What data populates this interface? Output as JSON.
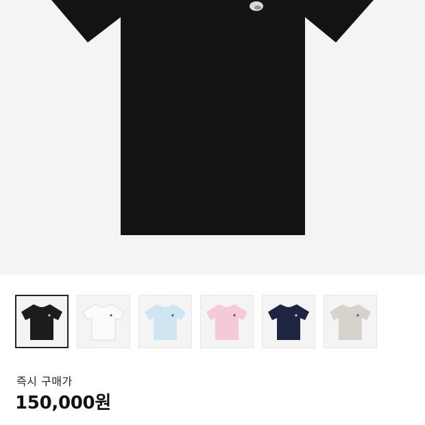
{
  "product": {
    "main_image_icon": "black-tshirt-image",
    "thumbnails": [
      {
        "name": "black",
        "color": "#1c1c1c",
        "logo": "#cfcfcf",
        "selected": true
      },
      {
        "name": "white",
        "color": "#fbfbfb",
        "logo": "#555555",
        "selected": false
      },
      {
        "name": "light-blue",
        "color": "#cfe6f2",
        "logo": "#555555",
        "selected": false
      },
      {
        "name": "pink",
        "color": "#f6c9d8",
        "logo": "#555555",
        "selected": false
      },
      {
        "name": "navy",
        "color": "#1d2540",
        "logo": "#cfcfcf",
        "selected": false
      },
      {
        "name": "grey",
        "color": "#d6d3cd",
        "logo": "#555555",
        "selected": false
      }
    ]
  },
  "pricing": {
    "label": "즉시 구매가",
    "price": "150,000원"
  }
}
